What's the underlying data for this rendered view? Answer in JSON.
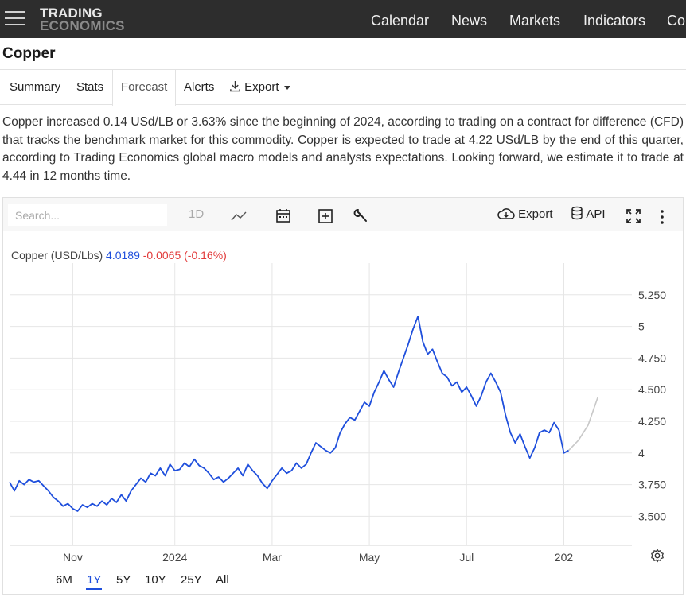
{
  "header": {
    "logo_line1": "TRADING",
    "logo_line2": "ECONOMICS",
    "nav": [
      {
        "label": "Calendar"
      },
      {
        "label": "News"
      },
      {
        "label": "Markets"
      },
      {
        "label": "Indicators"
      },
      {
        "label": "Co"
      }
    ]
  },
  "page": {
    "title": "Copper"
  },
  "tabs": [
    {
      "label": "Summary"
    },
    {
      "label": "Stats"
    },
    {
      "label": "Forecast",
      "active": true
    },
    {
      "label": "Alerts"
    },
    {
      "label": "Export",
      "icon": "download-icon"
    }
  ],
  "description": "Copper increased 0.14 USd/LB or 3.63% since the beginning of 2024, according to trading on a contract for difference (CFD) that tracks the benchmark market for this commodity. Copper is expected to trade at 4.22 USd/LB by the end of this quarter, according to Trading Economics global macro models and analysts expectations. Looking forward, we estimate it to trade at 4.44 in 12 months time.",
  "toolbar": {
    "search_placeholder": "Search...",
    "interval_label": "1D",
    "export_label": "Export",
    "api_label": "API",
    "icons": [
      "line-chart-icon",
      "calendar-icon",
      "add-box-icon",
      "wrench-icon",
      "cloud-download-icon",
      "database-icon",
      "fullscreen-icon",
      "more-vertical-icon"
    ]
  },
  "ticker": {
    "name": "Copper (USD/Lbs)",
    "price": "4.0189",
    "change": "-0.0065 (-0.16%)",
    "price_color": "#1f4fdc",
    "change_color": "#e23b3b"
  },
  "ranges": [
    {
      "label": "6M"
    },
    {
      "label": "1Y",
      "active": true
    },
    {
      "label": "5Y"
    },
    {
      "label": "10Y"
    },
    {
      "label": "25Y"
    },
    {
      "label": "All"
    }
  ],
  "chart_data": {
    "type": "line",
    "y_ticks": [
      "5.250",
      "5",
      "4.750",
      "4.500",
      "4.250",
      "4",
      "3.750",
      "3.500"
    ],
    "y_tick_values": [
      5.25,
      5.0,
      4.75,
      4.5,
      4.25,
      4.0,
      3.75,
      3.5
    ],
    "ylim": [
      3.27,
      5.5
    ],
    "x_ticks": [
      "Nov",
      "2024",
      "Mar",
      "May",
      "Jul",
      "202"
    ],
    "x_tick_months": [
      1.3,
      3.4,
      5.4,
      7.4,
      9.4,
      11.4
    ],
    "xlim": [
      0,
      12.8
    ],
    "grid": true,
    "series": [
      {
        "color": "#1f4fdc",
        "points": [
          [
            0.0,
            3.77
          ],
          [
            0.1,
            3.7
          ],
          [
            0.2,
            3.78
          ],
          [
            0.3,
            3.75
          ],
          [
            0.4,
            3.79
          ],
          [
            0.5,
            3.77
          ],
          [
            0.6,
            3.78
          ],
          [
            0.7,
            3.74
          ],
          [
            0.8,
            3.7
          ],
          [
            0.9,
            3.65
          ],
          [
            1.0,
            3.62
          ],
          [
            1.1,
            3.58
          ],
          [
            1.2,
            3.6
          ],
          [
            1.3,
            3.56
          ],
          [
            1.4,
            3.54
          ],
          [
            1.5,
            3.59
          ],
          [
            1.6,
            3.57
          ],
          [
            1.7,
            3.6
          ],
          [
            1.8,
            3.58
          ],
          [
            1.9,
            3.62
          ],
          [
            2.0,
            3.59
          ],
          [
            2.1,
            3.64
          ],
          [
            2.2,
            3.61
          ],
          [
            2.3,
            3.67
          ],
          [
            2.4,
            3.62
          ],
          [
            2.5,
            3.7
          ],
          [
            2.6,
            3.75
          ],
          [
            2.7,
            3.8
          ],
          [
            2.8,
            3.77
          ],
          [
            2.9,
            3.84
          ],
          [
            3.0,
            3.82
          ],
          [
            3.1,
            3.88
          ],
          [
            3.2,
            3.82
          ],
          [
            3.3,
            3.91
          ],
          [
            3.4,
            3.86
          ],
          [
            3.5,
            3.87
          ],
          [
            3.6,
            3.92
          ],
          [
            3.7,
            3.89
          ],
          [
            3.8,
            3.95
          ],
          [
            3.9,
            3.9
          ],
          [
            4.0,
            3.88
          ],
          [
            4.1,
            3.84
          ],
          [
            4.2,
            3.79
          ],
          [
            4.3,
            3.81
          ],
          [
            4.4,
            3.77
          ],
          [
            4.5,
            3.8
          ],
          [
            4.6,
            3.84
          ],
          [
            4.7,
            3.88
          ],
          [
            4.8,
            3.82
          ],
          [
            4.9,
            3.91
          ],
          [
            5.0,
            3.86
          ],
          [
            5.1,
            3.82
          ],
          [
            5.2,
            3.76
          ],
          [
            5.3,
            3.72
          ],
          [
            5.4,
            3.78
          ],
          [
            5.5,
            3.83
          ],
          [
            5.6,
            3.88
          ],
          [
            5.7,
            3.84
          ],
          [
            5.8,
            3.86
          ],
          [
            5.9,
            3.92
          ],
          [
            6.0,
            3.88
          ],
          [
            6.1,
            3.91
          ],
          [
            6.2,
            4.0
          ],
          [
            6.3,
            4.08
          ],
          [
            6.4,
            4.05
          ],
          [
            6.5,
            4.02
          ],
          [
            6.6,
            4.0
          ],
          [
            6.7,
            4.04
          ],
          [
            6.8,
            4.16
          ],
          [
            6.9,
            4.23
          ],
          [
            7.0,
            4.28
          ],
          [
            7.1,
            4.26
          ],
          [
            7.2,
            4.33
          ],
          [
            7.3,
            4.4
          ],
          [
            7.4,
            4.37
          ],
          [
            7.5,
            4.48
          ],
          [
            7.6,
            4.56
          ],
          [
            7.7,
            4.65
          ],
          [
            7.8,
            4.58
          ],
          [
            7.9,
            4.52
          ],
          [
            8.0,
            4.64
          ],
          [
            8.1,
            4.75
          ],
          [
            8.2,
            4.86
          ],
          [
            8.3,
            4.98
          ],
          [
            8.4,
            5.08
          ],
          [
            8.5,
            4.88
          ],
          [
            8.6,
            4.78
          ],
          [
            8.7,
            4.82
          ],
          [
            8.8,
            4.72
          ],
          [
            8.9,
            4.63
          ],
          [
            9.0,
            4.6
          ],
          [
            9.1,
            4.53
          ],
          [
            9.2,
            4.56
          ],
          [
            9.3,
            4.48
          ],
          [
            9.4,
            4.52
          ],
          [
            9.5,
            4.45
          ],
          [
            9.6,
            4.37
          ],
          [
            9.7,
            4.45
          ],
          [
            9.8,
            4.56
          ],
          [
            9.9,
            4.63
          ],
          [
            10.0,
            4.56
          ],
          [
            10.1,
            4.48
          ],
          [
            10.2,
            4.3
          ],
          [
            10.3,
            4.16
          ],
          [
            10.4,
            4.08
          ],
          [
            10.5,
            4.15
          ],
          [
            10.6,
            4.05
          ],
          [
            10.7,
            3.96
          ],
          [
            10.8,
            4.04
          ],
          [
            10.9,
            4.16
          ],
          [
            11.0,
            4.18
          ],
          [
            11.1,
            4.16
          ],
          [
            11.2,
            4.24
          ],
          [
            11.3,
            4.18
          ],
          [
            11.4,
            4.0
          ],
          [
            11.5,
            4.02
          ]
        ]
      },
      {
        "color": "#c8c8c8",
        "forecast": true,
        "points": [
          [
            11.5,
            4.02
          ],
          [
            11.7,
            4.1
          ],
          [
            11.9,
            4.22
          ],
          [
            12.1,
            4.44
          ]
        ]
      }
    ]
  }
}
